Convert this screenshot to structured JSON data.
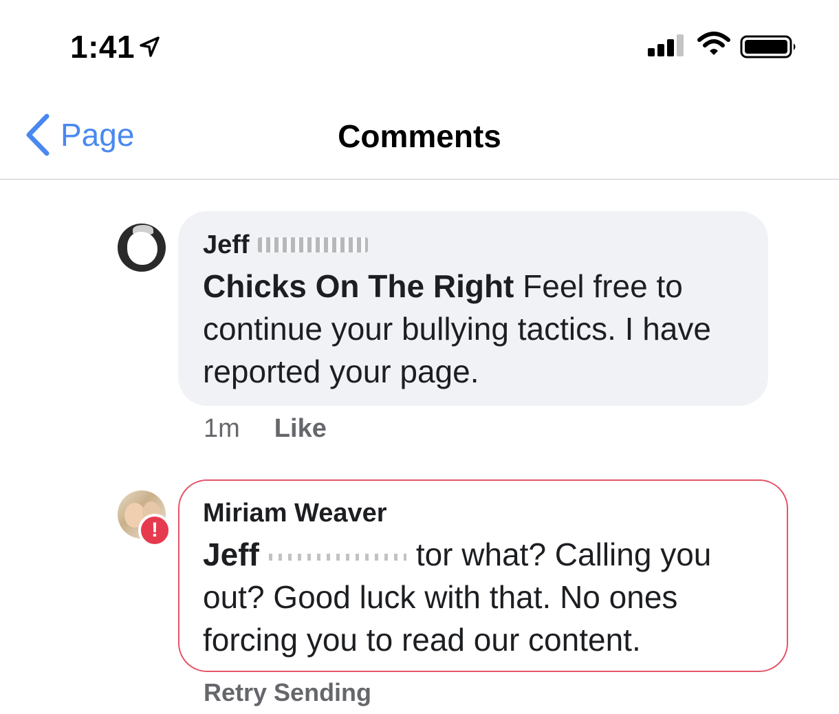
{
  "status_bar": {
    "time": "1:41"
  },
  "nav": {
    "back_label": "Page",
    "title": "Comments"
  },
  "comments": [
    {
      "author": "Jeff",
      "mention": "Chicks On The Right",
      "text": " Feel free to continue your bullying tactics. I have reported your page.",
      "time": "1m",
      "like_label": "Like"
    },
    {
      "author": "Miriam Weaver",
      "mention": "Jeff",
      "text": "tor what? Calling you out? Good luck with that. No ones forcing you to read our content.",
      "error_badge": "!",
      "retry_label": "Retry Sending"
    }
  ],
  "colors": {
    "accent": "#4a88f0",
    "bubble_bg": "#f0f2f5",
    "error_red": "#e63a4e",
    "error_border": "#e45468",
    "meta_gray": "#65676b"
  },
  "icons": {
    "location": "location-arrow-icon",
    "signal": "cellular-signal-icon",
    "wifi": "wifi-icon",
    "battery": "battery-icon",
    "back": "chevron-left-icon",
    "error": "exclamation-icon"
  }
}
